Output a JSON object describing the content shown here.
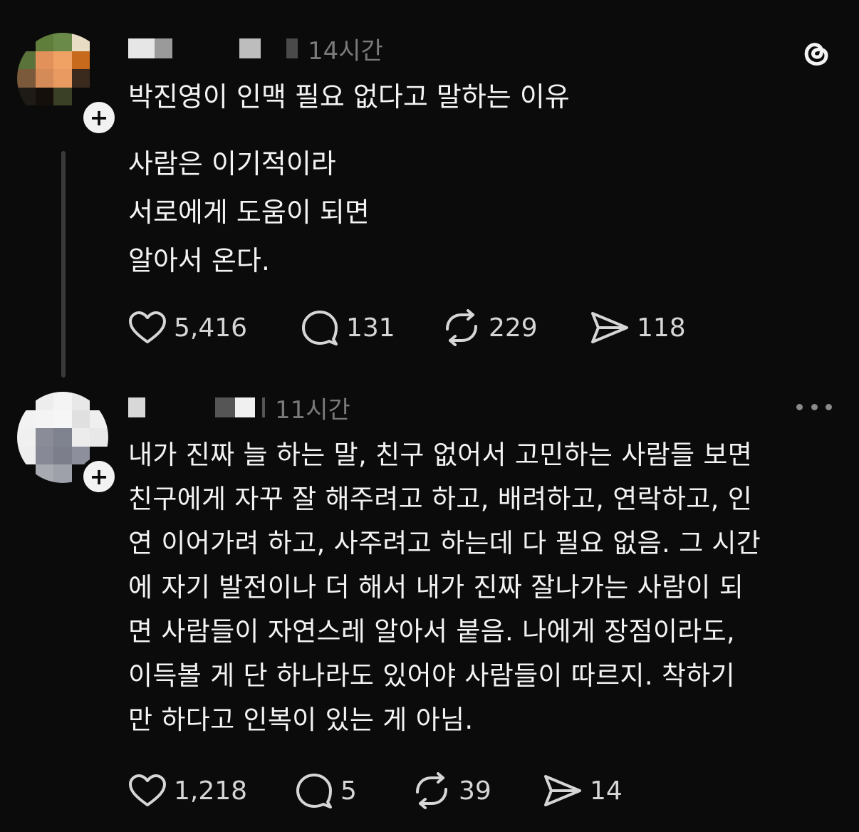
{
  "post": {
    "time": "14시간",
    "title": "박진영이 인맥 필요 없다고 말하는  이유",
    "body_lines": [
      "사람은 이기적이라",
      "서로에게 도움이 되면",
      "알아서 온다."
    ],
    "likes": "5,416",
    "replies": "131",
    "reposts": "229",
    "shares": "118"
  },
  "reply": {
    "time": "11시간",
    "body_lines": [
      "내가 진짜 늘 하는 말, 친구 없어서 고민하는 사람들 보면",
      "친구에게 자꾸 잘 해주려고 하고, 배려하고, 연락하고, 인",
      "연 이어가려 하고, 사주려고 하는데 다 필요 없음. 그 시간",
      "에 자기 발전이나 더 해서 내가 진짜 잘나가는 사람이 되",
      "면 사람들이 자연스레 알아서 붙음. 나에게 장점이라도,",
      "이득볼 게 단 하나라도 있어야 사람들이 따르지. 착하기",
      "만 하다고 인복이 있는 게 아님."
    ],
    "likes": "1,218",
    "replies": "5",
    "reposts": "39",
    "shares": "14"
  },
  "icons": {
    "app_logo": "threads-logo-icon",
    "like": "heart-icon",
    "reply": "comment-bubble-icon",
    "repost": "repost-arrows-icon",
    "share": "send-arrow-icon",
    "follow": "plus-icon",
    "more": "more-horizontal-icon"
  },
  "colors": {
    "background": "#0b0b0b",
    "text": "#f3f3f3",
    "muted": "#7a7a7a",
    "icon": "#d6d6d6"
  }
}
